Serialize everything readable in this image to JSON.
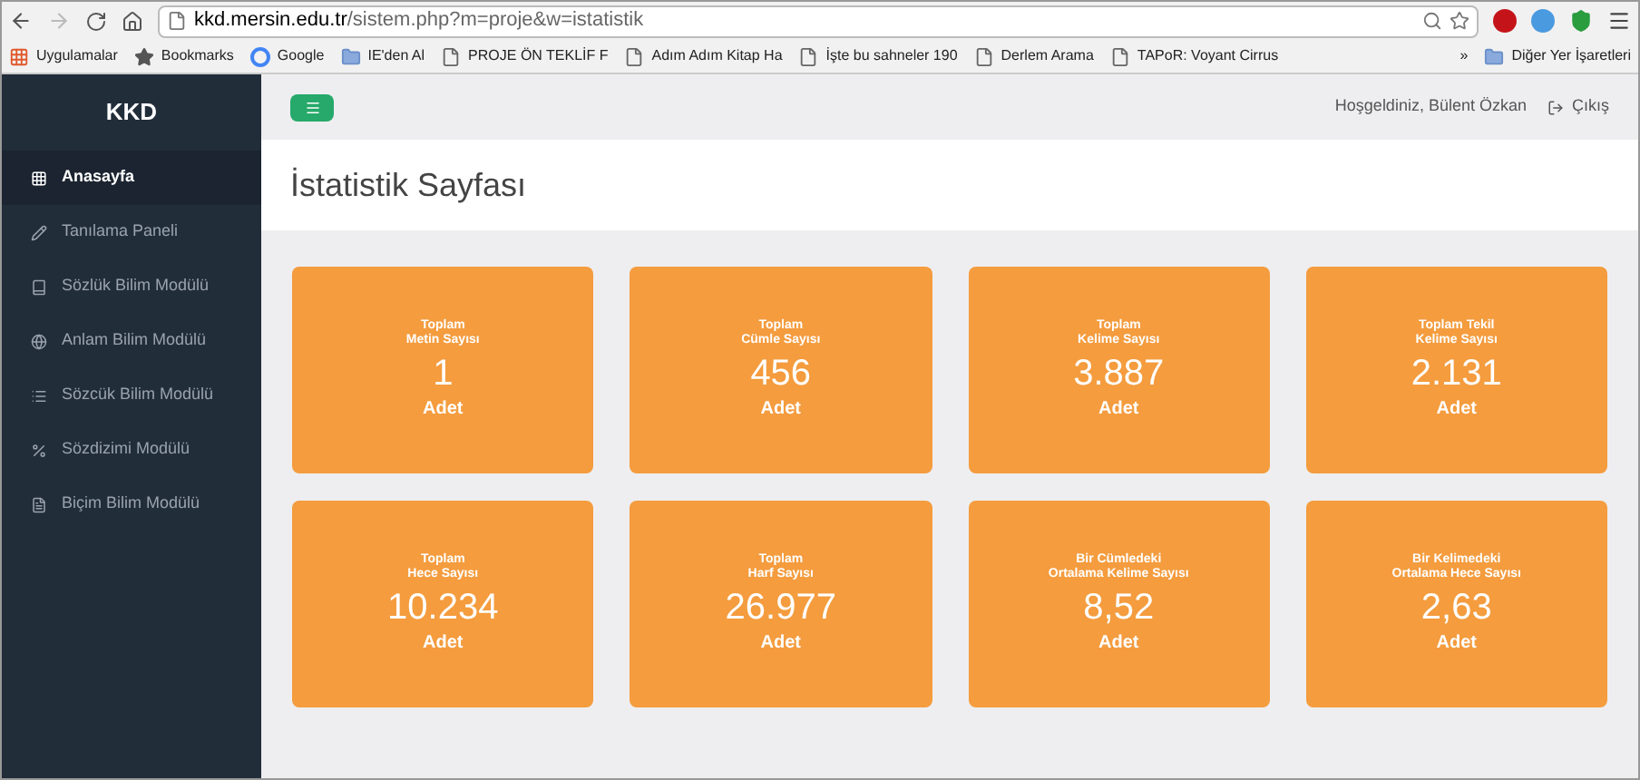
{
  "browser": {
    "url_host": "kkd.mersin.edu.tr",
    "url_path": "/sistem.php?m=proje&w=istatistik",
    "bookmarks": [
      {
        "label": "Uygulamalar",
        "kind": "apps"
      },
      {
        "label": "Bookmarks",
        "kind": "star"
      },
      {
        "label": "Google",
        "kind": "google"
      },
      {
        "label": "IE'den Al",
        "kind": "folder"
      },
      {
        "label": "PROJE ÖN TEKLİF F",
        "kind": "page"
      },
      {
        "label": "Adım Adım Kitap Ha",
        "kind": "page"
      },
      {
        "label": "İşte bu sahneler 190",
        "kind": "page"
      },
      {
        "label": "Derlem Arama",
        "kind": "page"
      },
      {
        "label": "TAPoR: Voyant Cirrus",
        "kind": "page"
      }
    ],
    "overflow": "»",
    "other_bookmarks": "Diğer Yer İşaretleri"
  },
  "sidebar": {
    "brand": "KKD",
    "items": [
      {
        "label": "Anasayfa",
        "kind": "grid",
        "selected": true
      },
      {
        "label": "Tanılama Paneli",
        "kind": "pencil",
        "selected": false
      },
      {
        "label": "Sözlük Bilim Modülü",
        "kind": "book",
        "selected": false
      },
      {
        "label": "Anlam Bilim Modülü",
        "kind": "globe",
        "selected": false
      },
      {
        "label": "Sözcük Bilim Modülü",
        "kind": "list",
        "selected": false
      },
      {
        "label": "Sözdizimi Modülü",
        "kind": "percent",
        "selected": false
      },
      {
        "label": "Biçim Bilim Modülü",
        "kind": "file",
        "selected": false
      }
    ]
  },
  "topbar": {
    "welcome": "Hoşgeldiniz, Bülent Özkan",
    "logout": "Çıkış"
  },
  "page_title": "İstatistik Sayfası",
  "cards": [
    {
      "title_1": "Toplam",
      "title_2": "Metin Sayısı",
      "value": "1",
      "unit": "Adet"
    },
    {
      "title_1": "Toplam",
      "title_2": "Cümle Sayısı",
      "value": "456",
      "unit": "Adet"
    },
    {
      "title_1": "Toplam",
      "title_2": "Kelime Sayısı",
      "value": "3.887",
      "unit": "Adet"
    },
    {
      "title_1": "Toplam Tekil",
      "title_2": "Kelime Sayısı",
      "value": "2.131",
      "unit": "Adet"
    },
    {
      "title_1": "Toplam",
      "title_2": "Hece Sayısı",
      "value": "10.234",
      "unit": "Adet"
    },
    {
      "title_1": "Toplam",
      "title_2": "Harf Sayısı",
      "value": "26.977",
      "unit": "Adet"
    },
    {
      "title_1": "Bir Cümledeki",
      "title_2": "Ortalama Kelime Sayısı",
      "value": "8,52",
      "unit": "Adet"
    },
    {
      "title_1": "Bir Kelimedeki",
      "title_2": "Ortalama Hece Sayısı",
      "value": "2,63",
      "unit": "Adet"
    }
  ]
}
